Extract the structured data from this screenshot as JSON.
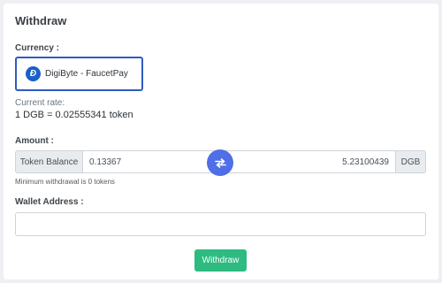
{
  "card": {
    "title": "Withdraw"
  },
  "currency": {
    "label": "Currency :",
    "selected": "DigiByte - FaucetPay",
    "icon": "digibyte-coin-icon",
    "rate_label": "Current rate:",
    "rate_value": "1 DGB = 0.02555341 token"
  },
  "amount": {
    "label": "Amount :",
    "left_addon": "Token Balance",
    "token_value": "0.13367",
    "coin_value": "5.23100439",
    "right_addon": "DGB",
    "swap_icon": "swap-arrows-icon",
    "min_note": "Minimum withdrawal is 0 tokens"
  },
  "wallet": {
    "label": "Wallet Address :",
    "value": ""
  },
  "submit": {
    "label": "Withdraw"
  },
  "colors": {
    "accent": "#2f5bc2",
    "swap": "#4f6fe8",
    "submit": "#2dbb81"
  }
}
